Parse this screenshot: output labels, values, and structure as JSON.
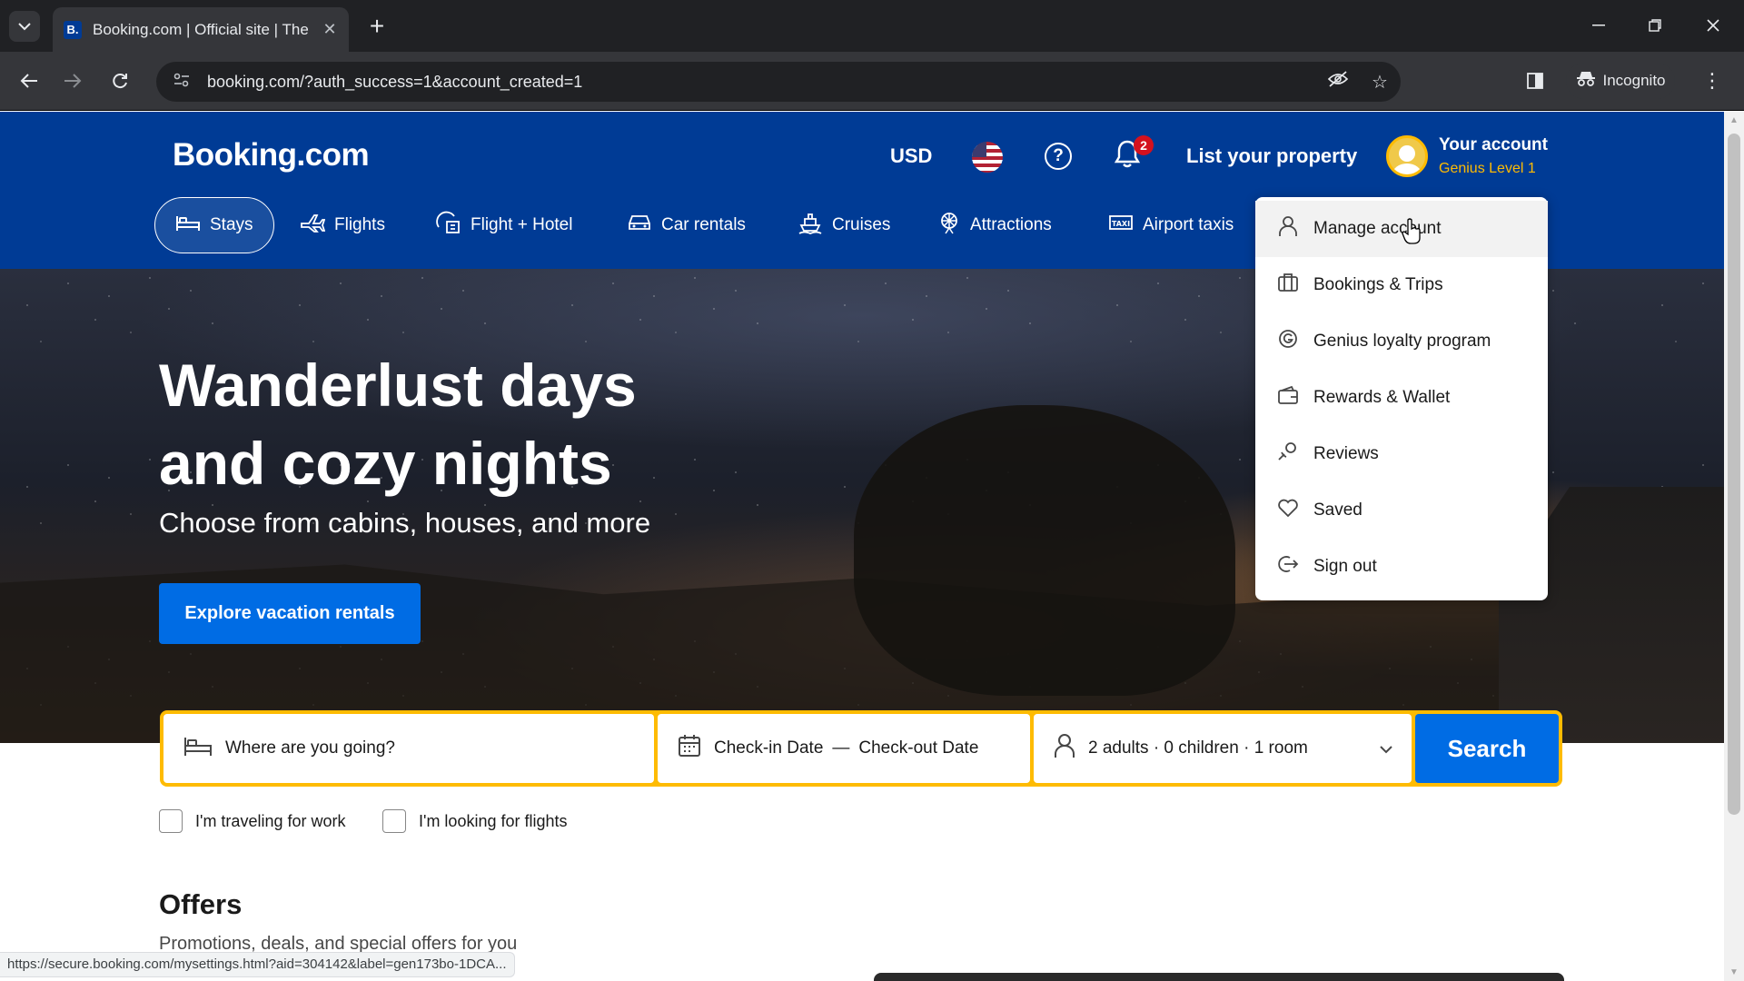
{
  "browser": {
    "tab_title": "Booking.com | Official site | The",
    "favicon": "B.",
    "url": "booking.com/?auth_success=1&account_created=1",
    "incognito_label": "Incognito",
    "status_url": "https://secure.booking.com/mysettings.html?aid=304142&label=gen173bo-1DCA..."
  },
  "header": {
    "logo": "Booking.com",
    "currency": "USD",
    "notification_count": "2",
    "list_property": "List your property",
    "account_name": "Your account",
    "account_level": "Genius Level 1"
  },
  "nav": {
    "tabs": [
      {
        "label": "Stays",
        "icon": "bed-icon"
      },
      {
        "label": "Flights",
        "icon": "plane-icon"
      },
      {
        "label": "Flight + Hotel",
        "icon": "plane-hotel-icon"
      },
      {
        "label": "Car rentals",
        "icon": "car-icon"
      },
      {
        "label": "Cruises",
        "icon": "ship-icon"
      },
      {
        "label": "Attractions",
        "icon": "attractions-icon"
      },
      {
        "label": "Airport taxis",
        "icon": "taxi-icon"
      }
    ]
  },
  "account_menu": {
    "items": [
      {
        "label": "Manage account",
        "icon": "person-icon"
      },
      {
        "label": "Bookings & Trips",
        "icon": "suitcase-icon"
      },
      {
        "label": "Genius loyalty program",
        "icon": "genius-icon"
      },
      {
        "label": "Rewards & Wallet",
        "icon": "wallet-icon"
      },
      {
        "label": "Reviews",
        "icon": "reviews-icon"
      },
      {
        "label": "Saved",
        "icon": "heart-icon"
      },
      {
        "label": "Sign out",
        "icon": "sign-out-icon"
      }
    ]
  },
  "hero": {
    "title_line1": "Wanderlust days",
    "title_line2": "and cozy nights",
    "subtitle": "Choose from cabins, houses, and more",
    "cta": "Explore vacation rentals"
  },
  "search": {
    "destination_placeholder": "Where are you going?",
    "checkin": "Check-in Date",
    "separator": "—",
    "checkout": "Check-out Date",
    "guests": "2 adults · 0 children · 1 room",
    "button": "Search",
    "work_travel": "I'm traveling for work",
    "flights": "I'm looking for flights"
  },
  "offers": {
    "title": "Offers",
    "subtitle": "Promotions, deals, and special offers for you"
  },
  "colors": {
    "brand_blue": "#003b95",
    "action_blue": "#006ce4",
    "genius_yellow": "#febb02",
    "badge_red": "#d4111e"
  }
}
